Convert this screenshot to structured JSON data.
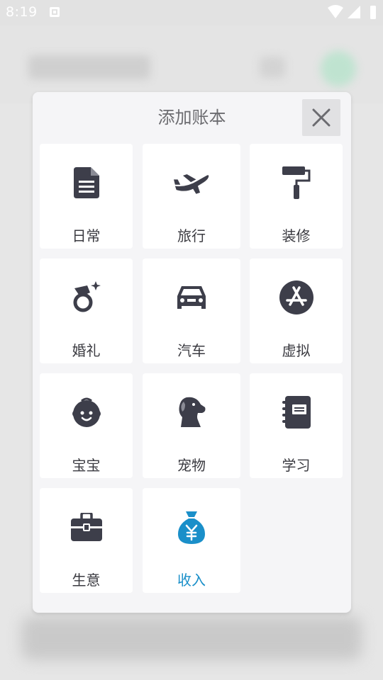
{
  "status_bar": {
    "time": "8:19"
  },
  "dialog": {
    "title": "添加账本",
    "close_icon": "close-icon",
    "items": [
      {
        "label": "日常",
        "icon": "document-icon",
        "accent": false
      },
      {
        "label": "旅行",
        "icon": "airplane-icon",
        "accent": false
      },
      {
        "label": "装修",
        "icon": "paint-roller-icon",
        "accent": false
      },
      {
        "label": "婚礼",
        "icon": "diamond-ring-icon",
        "accent": false
      },
      {
        "label": "汽车",
        "icon": "car-icon",
        "accent": false
      },
      {
        "label": "虚拟",
        "icon": "app-store-icon",
        "accent": false
      },
      {
        "label": "宝宝",
        "icon": "baby-face-icon",
        "accent": false
      },
      {
        "label": "宠物",
        "icon": "dog-icon",
        "accent": false
      },
      {
        "label": "学习",
        "icon": "notebook-icon",
        "accent": false
      },
      {
        "label": "生意",
        "icon": "briefcase-icon",
        "accent": false
      },
      {
        "label": "收入",
        "icon": "money-bag-yen-icon",
        "accent": true
      }
    ]
  },
  "colors": {
    "icon_dark": "#3d3e4a",
    "accent": "#1a8fc9"
  }
}
